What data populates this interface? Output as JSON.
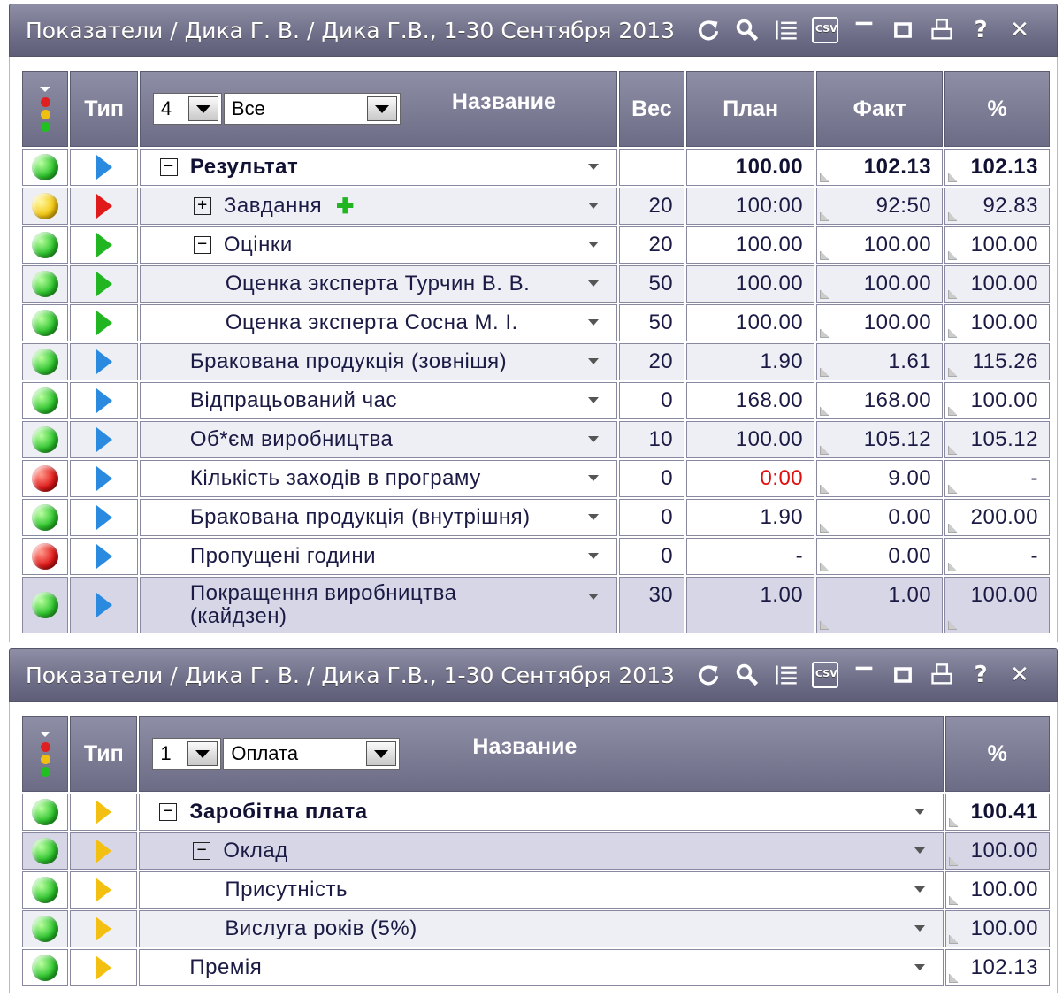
{
  "panel1": {
    "title": "Показатели / Дика Г. В. / Дика Г.В., 1-30 Сентября 2013",
    "headers": {
      "type": "Тип",
      "name": "Название",
      "weight": "Вес",
      "plan": "План",
      "fact": "Факт",
      "percent": "%"
    },
    "level_select": "4",
    "filter_select": "Все",
    "rows": [
      {
        "lamp": "green",
        "arrow": "blue",
        "expander": "−",
        "name": "Результат",
        "weight": "",
        "plan": "100.00",
        "fact": "102.13",
        "percent": "102.13"
      },
      {
        "lamp": "yellow",
        "arrow": "red",
        "expander": "+",
        "name": "Завдання",
        "plus": "✚",
        "weight": "20",
        "plan": "100:00",
        "fact": "92:50",
        "percent": "92.83"
      },
      {
        "lamp": "green",
        "arrow": "green",
        "expander": "−",
        "name": "Оцінки",
        "weight": "20",
        "plan": "100.00",
        "fact": "100.00",
        "percent": "100.00"
      },
      {
        "lamp": "green",
        "arrow": "green",
        "name": "Оценка эксперта Турчин В. В.",
        "weight": "50",
        "plan": "100.00",
        "fact": "100.00",
        "percent": "100.00"
      },
      {
        "lamp": "green",
        "arrow": "green",
        "name": "Оценка эксперта Сосна М. І.",
        "weight": "50",
        "plan": "100.00",
        "fact": "100.00",
        "percent": "100.00"
      },
      {
        "lamp": "green",
        "arrow": "blue",
        "name": "Бракована продукція (зовнішя)",
        "weight": "20",
        "plan": "1.90",
        "fact": "1.61",
        "percent": "115.26"
      },
      {
        "lamp": "green",
        "arrow": "blue",
        "name": "Відпрацьований час",
        "weight": "0",
        "plan": "168.00",
        "fact": "168.00",
        "percent": "100.00"
      },
      {
        "lamp": "green",
        "arrow": "blue",
        "name": "Об*єм виробництва",
        "weight": "10",
        "plan": "100.00",
        "fact": "105.12",
        "percent": "105.12"
      },
      {
        "lamp": "red",
        "arrow": "blue",
        "name": "Кількість заходів в програму",
        "weight": "0",
        "plan": "0:00",
        "fact": "9.00",
        "percent": "-"
      },
      {
        "lamp": "green",
        "arrow": "blue",
        "name": "Бракована продукція (внутрішня)",
        "weight": "0",
        "plan": "1.90",
        "fact": "0.00",
        "percent": "200.00"
      },
      {
        "lamp": "red",
        "arrow": "blue",
        "name": "Пропущені години",
        "weight": "0",
        "plan": "-",
        "fact": "0.00",
        "percent": "-"
      },
      {
        "lamp": "green",
        "arrow": "blue",
        "name": "Покращення виробництва (кайдзен)",
        "weight": "30",
        "plan": "1.00",
        "fact": "1.00",
        "percent": "100.00"
      }
    ]
  },
  "panel2": {
    "title": "Показатели / Дика Г. В. / Дика Г.В., 1-30 Сентября 2013",
    "headers": {
      "type": "Тип",
      "name": "Название",
      "percent": "%"
    },
    "level_select": "1",
    "filter_select": "Оплата",
    "rows": [
      {
        "lamp": "green",
        "arrow": "yellow",
        "expander": "−",
        "name": "Заробітна плата",
        "percent": "100.41"
      },
      {
        "lamp": "green",
        "arrow": "yellow",
        "expander": "−",
        "name": "Оклад",
        "percent": "100.00"
      },
      {
        "lamp": "green",
        "arrow": "yellow",
        "name": "Присутність",
        "percent": "100.00"
      },
      {
        "lamp": "green",
        "arrow": "yellow",
        "name": "Вислуга років (5%)",
        "percent": "100.00"
      },
      {
        "lamp": "green",
        "arrow": "yellow",
        "name": "Премія",
        "percent": "102.13"
      }
    ]
  },
  "toolbar_icons": [
    "refresh-icon",
    "search-icon",
    "list-icon",
    "csv-export-icon",
    "minimize-icon",
    "maximize-icon",
    "print-icon",
    "help-icon",
    "close-icon"
  ],
  "csv_label": "CSV",
  "colors": {
    "titlebar": "#7a7a94",
    "header": "#7c7c96",
    "row_alt": "#eeeef5",
    "row_highlight": "#d6d6e6",
    "negative_text": "#e01010"
  }
}
